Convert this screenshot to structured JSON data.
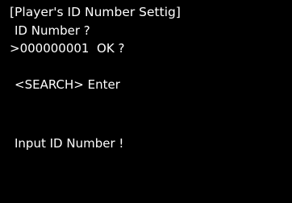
{
  "screen": {
    "title": "[Player's ID Number Settig]",
    "prompt": "ID Number ?",
    "entry": {
      "cursor": ">",
      "value": "000000001",
      "confirm": "OK ?"
    },
    "search_label": "<SEARCH> Enter",
    "hint": "Input ID Number !"
  },
  "colors": {
    "background": "#000000",
    "text": "#ffffff"
  }
}
